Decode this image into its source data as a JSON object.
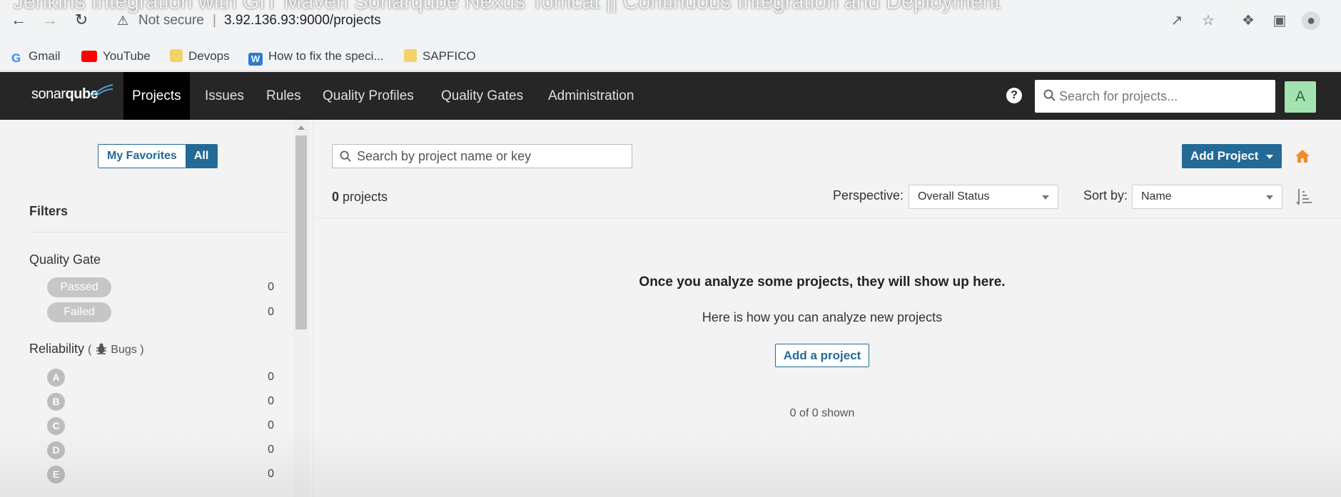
{
  "video_title": "Jenkins Integration with GIT Maven Sonarqube Nexus Tomcat || Continuous Integration and Deployment",
  "browser": {
    "security_label": "Not secure",
    "url": "3.92.136.93:9000/projects",
    "bookmarks": [
      {
        "label": "Gmail",
        "icon": "google-icon",
        "color": "#4285f4"
      },
      {
        "label": "YouTube",
        "icon": "youtube-icon",
        "color": "#ff0000"
      },
      {
        "label": "Devops",
        "icon": "folder-icon",
        "color": "#f4d26b"
      },
      {
        "label": "How to fix the speci...",
        "icon": "word-icon",
        "color": "#2b7cd3"
      },
      {
        "label": "SAPFICO",
        "icon": "folder-icon",
        "color": "#f4d26b"
      }
    ]
  },
  "nav": {
    "logo": {
      "part1": "sonar",
      "part2": "qube"
    },
    "items": [
      "Projects",
      "Issues",
      "Rules",
      "Quality Profiles",
      "Quality Gates",
      "Administration"
    ],
    "active": "Projects",
    "search_placeholder": "Search for projects...",
    "avatar_letter": "A"
  },
  "sidebar": {
    "toggle": {
      "favorites": "My Favorites",
      "all": "All",
      "selected": "All"
    },
    "filters_title": "Filters",
    "quality_gate": {
      "title": "Quality Gate",
      "options": [
        {
          "label": "Passed",
          "count": "0"
        },
        {
          "label": "Failed",
          "count": "0"
        }
      ]
    },
    "reliability": {
      "title": "Reliability",
      "open_paren": "(",
      "metric": "Bugs",
      "close_paren": ")",
      "ratings": [
        {
          "label": "A",
          "count": "0"
        },
        {
          "label": "B",
          "count": "0"
        },
        {
          "label": "C",
          "count": "0"
        },
        {
          "label": "D",
          "count": "0"
        },
        {
          "label": "E",
          "count": "0"
        }
      ]
    }
  },
  "main": {
    "search_placeholder": "Search by project name or key",
    "add_project_label": "Add Project",
    "project_count": "0",
    "project_count_suffix": "projects",
    "perspective_label": "Perspective:",
    "perspective_value": "Overall Status",
    "sort_label": "Sort by:",
    "sort_value": "Name",
    "empty_title": "Once you analyze some projects, they will show up here.",
    "empty_subtitle": "Here is how you can analyze new projects",
    "add_a_project_label": "Add a project",
    "shown_text": "0 of 0 shown"
  },
  "colors": {
    "nav_bg": "#262626",
    "accent": "#236a97",
    "avatar_bg": "#a3e3b0",
    "home_icon": "#f28c28"
  }
}
